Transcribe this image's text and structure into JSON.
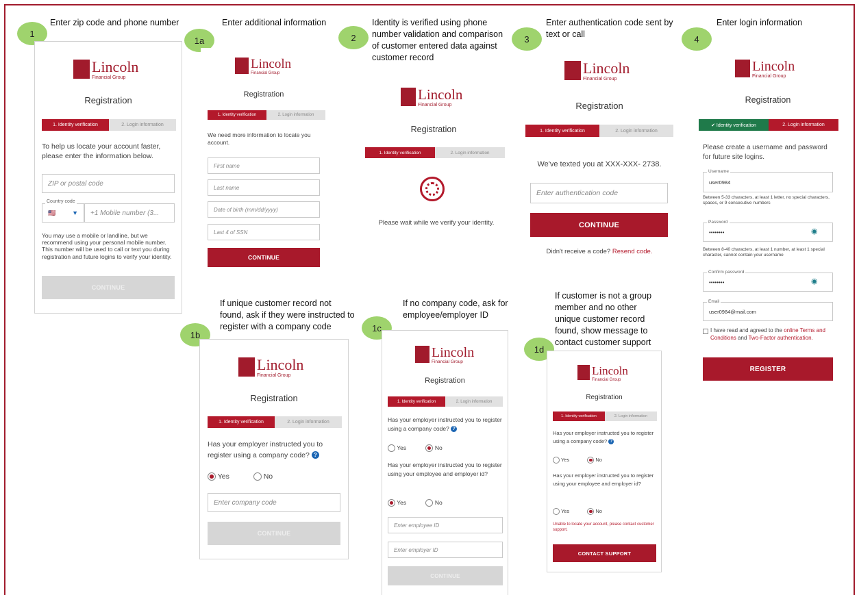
{
  "colors": {
    "accent": "#a8192b",
    "success": "#1f7a4a",
    "badge": "#9fd36d",
    "link": "#b3192b"
  },
  "brand": {
    "name": "Lincoln",
    "sub": "Financial Group"
  },
  "common": {
    "title": "Registration",
    "step1": "1. Identity verification",
    "step2": "2. Login information",
    "step1_done": "✔ Identity verification"
  },
  "s1": {
    "badge": "1",
    "caption": "Enter zip code and phone number",
    "intro": "To help us locate your account faster, please enter the information below.",
    "zip_placeholder": "ZIP or postal code",
    "country_label": "Country code",
    "country_flag": "🇺🇸",
    "phone_placeholder": "+1 Mobile number (3...",
    "note": "You may use a mobile or landline, but we recommend using your personal mobile number. This number will be used to call or text you during registration and future logins to verify your identity.",
    "button": "CONTINUE"
  },
  "s1a": {
    "badge": "1a",
    "caption": "Enter additional information",
    "intro": "We need more information to locate you account.",
    "first": "First name",
    "last": "Last name",
    "dob": "Date of birth (mm/dd/yyyy)",
    "ssn": "Last 4 of SSN",
    "button": "CONTINUE"
  },
  "s2": {
    "badge": "2",
    "caption": "Identity is verified using phone number validation and comparison of customer entered data against customer record",
    "wait": "Please wait while we verify your identity."
  },
  "s3": {
    "badge": "3",
    "caption": "Enter authentication code sent by text or call",
    "texted": "We've texted you at XXX-XXX- 2738.",
    "code_placeholder": "Enter authentication code",
    "button": "CONTINUE",
    "no_code": "Didn't receive a code?",
    "resend": "Resend code."
  },
  "s4": {
    "badge": "4",
    "caption": "Enter login information",
    "intro": "Please create a username and password for future site logins.",
    "username_label": "Username",
    "username": "user0984",
    "username_hint": "Between 5-33 characters, at least 1 letter, no special characters, spaces, or 9 consecutive numbers",
    "password_label": "Password",
    "password": "••••••••",
    "password_hint": "Between 8-40 characters, at least 1 number, at least 1 special character, cannot contain your username",
    "confirm_label": "Confirm password",
    "confirm": "••••••••",
    "email_label": "Email",
    "email": "user0984@mail.com",
    "agree_pre": "I have read and agreed to the",
    "agree_terms": "online Terms and Conditions",
    "agree_and": "and",
    "agree_2fa": "Two-Factor authentication.",
    "button": "REGISTER"
  },
  "s1b": {
    "badge": "1b",
    "caption": "If unique customer record not found, ask if they were instructed to register with a company code",
    "question": "Has your employer instructed you to register using a company code?",
    "yes": "Yes",
    "no": "No",
    "code_placeholder": "Enter company code",
    "button": "CONTINUE"
  },
  "s1c": {
    "badge": "1c",
    "caption": "If no company code, ask for employee/employer ID",
    "question1": "Has your employer instructed you to register using a company code?",
    "question2": "Has your employer instructed you to register using your employee and employer id?",
    "yes": "Yes",
    "no": "No",
    "employee_placeholder": "Enter employee ID",
    "employer_placeholder": "Enter employer ID",
    "button": "CONTINUE"
  },
  "s1d": {
    "badge": "1d",
    "caption": "If customer is not a group member and no other unique customer record found, show message to contact customer support",
    "question1": "Has your employer instructed you to register using a company code?",
    "question2": "Has your employer instructed you to register using your employee and employer id?",
    "yes": "Yes",
    "no": "No",
    "error": "Unable to locate your account, please contact customer support.",
    "button": "CONTACT SUPPORT"
  }
}
